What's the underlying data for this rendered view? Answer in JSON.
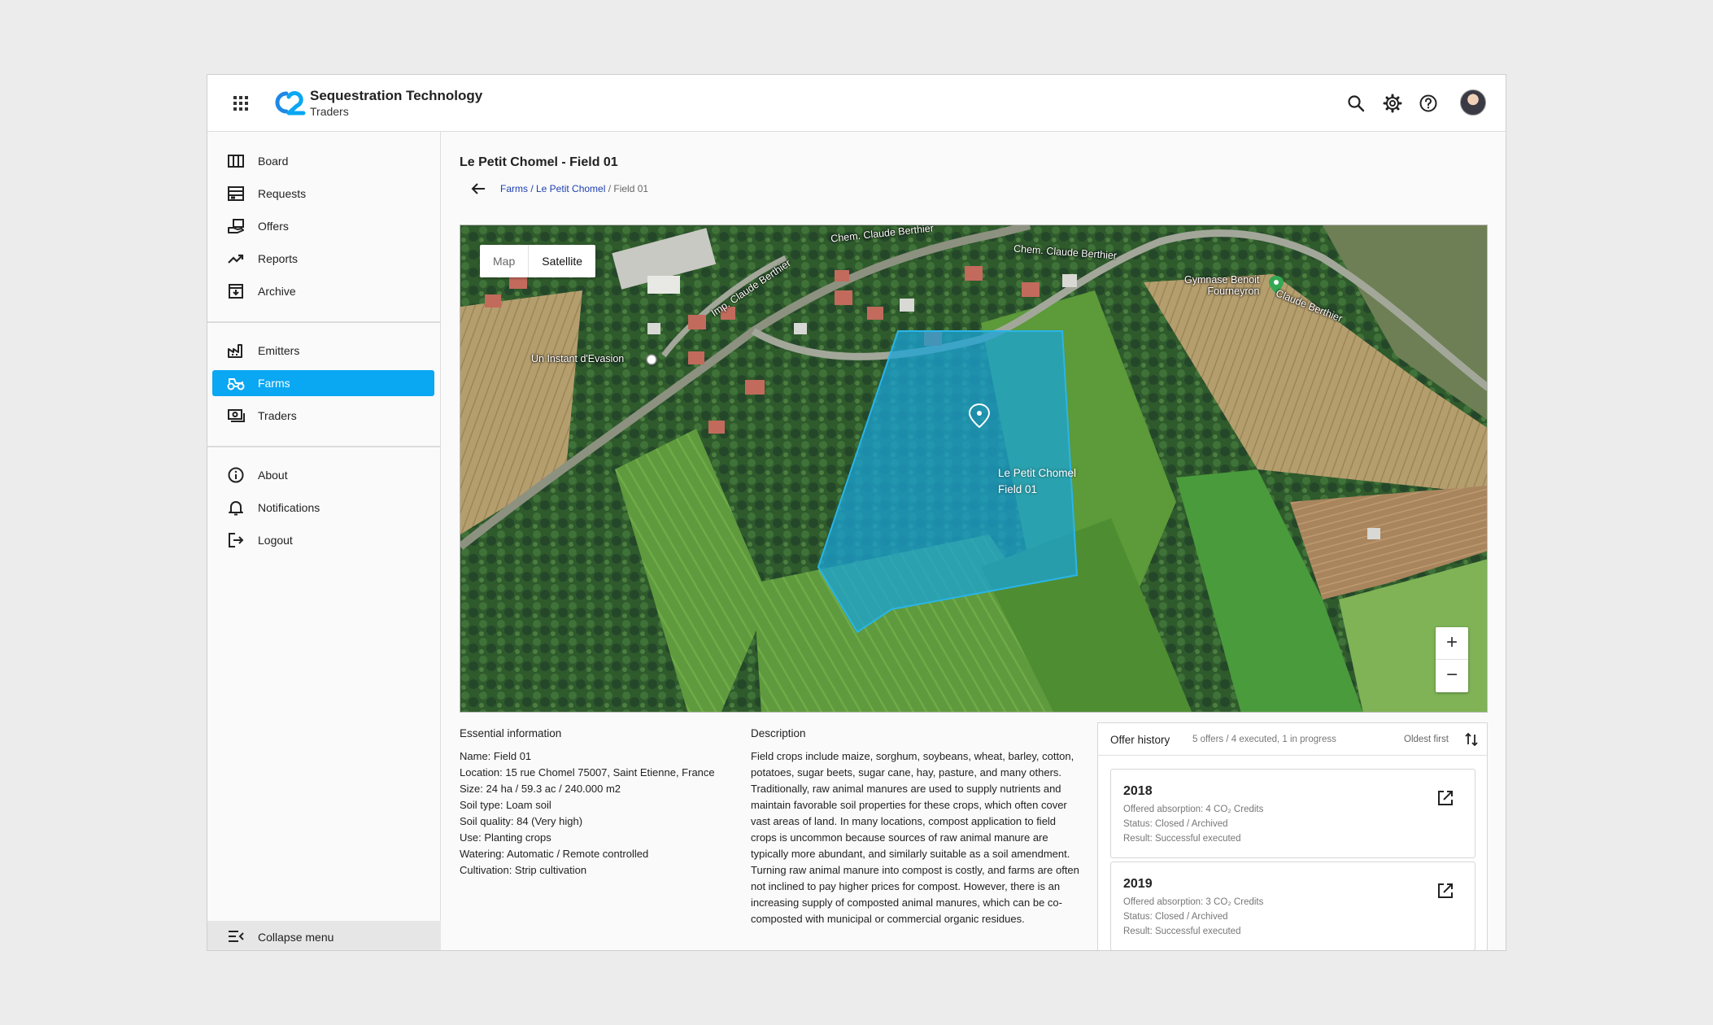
{
  "app": {
    "title": "Sequestration Technology",
    "subtitle": "Traders"
  },
  "topbar_icons": [
    "search-icon",
    "gear-icon",
    "help-icon",
    "avatar"
  ],
  "sidebar": {
    "items": [
      {
        "label": "Board",
        "icon": "board-icon"
      },
      {
        "label": "Requests",
        "icon": "requests-icon"
      },
      {
        "label": "Offers",
        "icon": "offers-icon"
      },
      {
        "label": "Reports",
        "icon": "trending-icon"
      },
      {
        "label": "Archive",
        "icon": "archive-icon"
      },
      {
        "label": "Emitters",
        "icon": "factory-icon"
      },
      {
        "label": "Farms",
        "icon": "tractor-icon",
        "active": true
      },
      {
        "label": "Traders",
        "icon": "money-icon"
      },
      {
        "label": "About",
        "icon": "info-icon"
      },
      {
        "label": "Notifications",
        "icon": "bell-icon"
      },
      {
        "label": "Logout",
        "icon": "logout-icon"
      }
    ],
    "collapse_label": "Collapse menu",
    "active_color": "#0aa7f3"
  },
  "page": {
    "title": "Le Petit Chomel - Field 01",
    "breadcrumb": {
      "link": "Farms / Le Petit Chomel",
      "sep": " / ",
      "current": "Field 01"
    }
  },
  "map": {
    "toggle": {
      "map": "Map",
      "satellite": "Satellite",
      "selected": "Satellite"
    },
    "zoom_in": "+",
    "zoom_out": "−",
    "labels": {
      "road1": "Chem. Claude Berthier",
      "road2": "Chem. Claude Berthier",
      "road3": "Imp. Claude Berthier",
      "road4": "Claude Berthier",
      "poi1": "Un Instant d'Evasion",
      "poi2_line1": "Gymnase Benoit",
      "poi2_line2": "Fourneyron"
    },
    "field_label_line1": "Le Petit Chomel",
    "field_label_line2": "Field 01",
    "field_color": "#1aa3d6"
  },
  "essential": {
    "title": "Essential information",
    "lines": [
      "Name: Field 01",
      "Location: 15 rue Chomel 75007, Saint Etienne, France",
      "Size: 24 ha / 59.3 ac / 240.000 m2",
      "Soil type: Loam soil",
      "Soil quality: 84 (Very high)",
      "Use: Planting crops",
      "Watering: Automatic / Remote controlled",
      "Cultivation: Strip cultivation"
    ]
  },
  "description": {
    "title": "Description",
    "text": "Field crops include maize, sorghum, soybeans, wheat, barley, cotton, potatoes, sugar beets, sugar cane, hay, pasture, and many others. Traditionally, raw animal manures are used to supply nutrients and maintain favorable soil properties for these crops, which often cover vast areas of land. In many locations, compost application to field crops is uncommon because sources of raw animal manure are typically more abundant, and similarly suitable as a soil amendment. Turning raw animal manure into compost is costly, and farms are often not inclined to pay higher prices for compost. However, there is an increasing supply of composted animal manures, which can be co-composted with municipal or commercial organic residues."
  },
  "offer_history": {
    "title": "Offer history",
    "summary": "5 offers / 4 executed, 1 in progress",
    "sort_label": "Oldest first",
    "items": [
      {
        "year": "2018",
        "absorption": "Offered absorption: 4 CO₂ Credits",
        "status": "Status: Closed / Archived",
        "result": "Result: Successful executed"
      },
      {
        "year": "2019",
        "absorption": "Offered absorption: 3 CO₂ Credits",
        "status": "Status: Closed / Archived",
        "result": "Result: Successful executed"
      }
    ]
  }
}
